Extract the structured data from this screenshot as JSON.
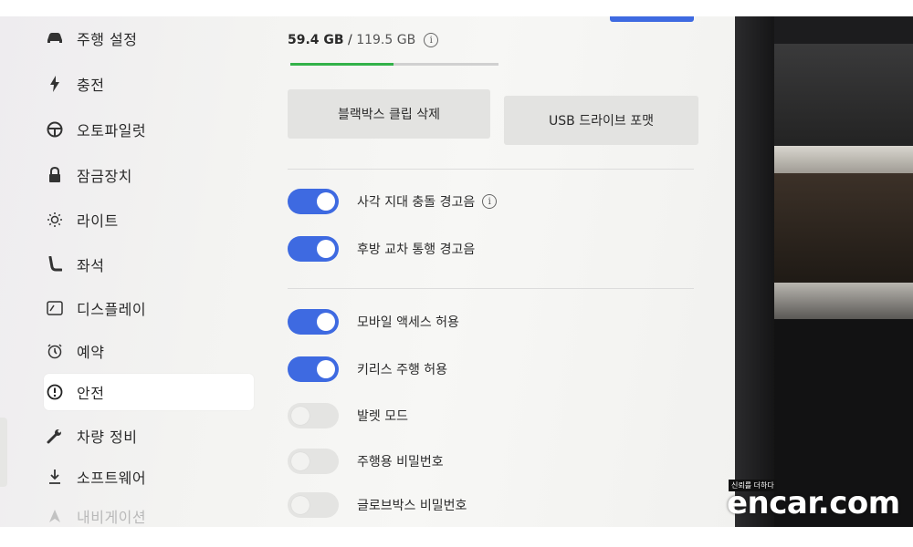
{
  "sidebar": {
    "items": [
      {
        "label": "주행 설정",
        "icon": "car-icon",
        "glyph": "🚘",
        "active": false
      },
      {
        "label": "충전",
        "icon": "lightning-icon",
        "glyph": "ϟ",
        "active": false
      },
      {
        "label": "오토파일럿",
        "icon": "steering-wheel-icon",
        "glyph": "⊕",
        "active": false
      },
      {
        "label": "잠금장치",
        "icon": "lock-icon",
        "glyph": "🔒",
        "active": false
      },
      {
        "label": "라이트",
        "icon": "light-icon",
        "glyph": "☼",
        "active": false
      },
      {
        "label": "좌석",
        "icon": "seat-icon",
        "glyph": "⌊",
        "active": false
      },
      {
        "label": "디스플레이",
        "icon": "display-icon",
        "glyph": "▭",
        "active": false
      },
      {
        "label": "예약",
        "icon": "alarm-clock-icon",
        "glyph": "⏰",
        "active": false
      },
      {
        "label": "안전",
        "icon": "exclamation-circle-icon",
        "glyph": "ⓘ",
        "active": true
      },
      {
        "label": "차량 정비",
        "icon": "wrench-icon",
        "glyph": "🔧",
        "active": false
      },
      {
        "label": "소프트웨어",
        "icon": "download-icon",
        "glyph": "⤓",
        "active": false
      },
      {
        "label": "내비게이션",
        "icon": "navigation-icon",
        "glyph": "▲",
        "active": false
      }
    ]
  },
  "storage": {
    "used": "59.4 GB",
    "separator": " / ",
    "total": "119.5 GB",
    "used_fraction": 0.497,
    "fill_color": "#33b249"
  },
  "actions": {
    "delete_clips_label": "블랙박스 클립 삭제",
    "format_usb_label": "USB 드라이브 포맷"
  },
  "toggles": [
    {
      "label": "사각 지대 충돌 경고음",
      "on": true,
      "info": true
    },
    {
      "label": "후방 교차 통행 경고음",
      "on": true,
      "info": false
    },
    {
      "label": "모바일 액세스 허용",
      "on": true,
      "info": false
    },
    {
      "label": "키리스 주행 허용",
      "on": true,
      "info": false
    },
    {
      "label": "발렛 모드",
      "on": false,
      "info": false
    },
    {
      "label": "주행용 비밀번호",
      "on": false,
      "info": false
    },
    {
      "label": "글로브박스 비밀번호",
      "on": false,
      "info": false
    }
  ],
  "colors": {
    "accent": "#3e6ae1",
    "toggle_off": "#e4e4e2"
  },
  "watermark": {
    "tagline": "신뢰를 더하다",
    "brand": "encar.com"
  }
}
